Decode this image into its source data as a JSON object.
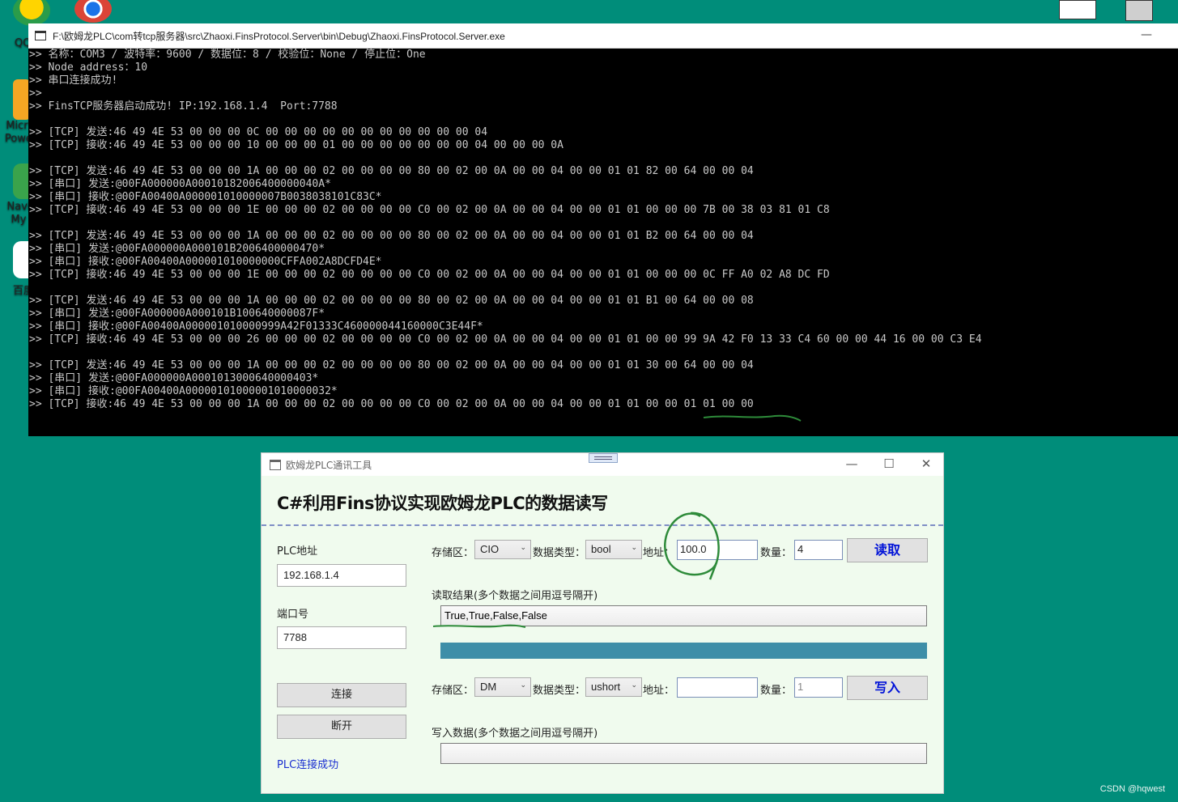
{
  "desktop": {
    "icons": [
      {
        "label": "QQ"
      },
      {
        "label": ""
      },
      {
        "label": "Micr Powe"
      },
      {
        "label": "Navi My"
      },
      {
        "label": "百度"
      }
    ]
  },
  "console": {
    "title": "F:\\欧姆龙PLC\\com转tcp服务器\\src\\Zhaoxi.FinsProtocol.Server\\bin\\Debug\\Zhaoxi.FinsProtocol.Server.exe",
    "min_label": "—",
    "lines": [
      ">> 名称：COM3 / 波特率：9600 / 数据位：8 / 校验位：None / 停止位：One",
      ">> Node address：10",
      ">> 串口连接成功!",
      ">>",
      ">> FinsTCP服务器启动成功! IP:192.168.1.4  Port:7788",
      "",
      ">> [TCP] 发送:46 49 4E 53 00 00 00 0C 00 00 00 00 00 00 00 00 00 00 00 04",
      ">> [TCP] 接收:46 49 4E 53 00 00 00 10 00 00 00 01 00 00 00 00 00 00 00 04 00 00 00 0A",
      "",
      ">> [TCP] 发送:46 49 4E 53 00 00 00 1A 00 00 00 02 00 00 00 00 80 00 02 00 0A 00 00 04 00 00 01 01 82 00 64 00 00 04",
      ">> [串口] 发送:@00FA000000A00010182006400000040A*",
      ">> [串口] 接收:@00FA00400A000001010000007B0038038101C83C*",
      ">> [TCP] 接收:46 49 4E 53 00 00 00 1E 00 00 00 02 00 00 00 00 C0 00 02 00 0A 00 00 04 00 00 01 01 00 00 00 7B 00 38 03 81 01 C8",
      "",
      ">> [TCP] 发送:46 49 4E 53 00 00 00 1A 00 00 00 02 00 00 00 00 80 00 02 00 0A 00 00 04 00 00 01 01 B2 00 64 00 00 04",
      ">> [串口] 发送:@00FA000000A000101B2006400000470*",
      ">> [串口] 接收:@00FA00400A000001010000000CFFA002A8DCFD4E*",
      ">> [TCP] 接收:46 49 4E 53 00 00 00 1E 00 00 00 02 00 00 00 00 C0 00 02 00 0A 00 00 04 00 00 01 01 00 00 00 0C FF A0 02 A8 DC FD",
      "",
      ">> [TCP] 发送:46 49 4E 53 00 00 00 1A 00 00 00 02 00 00 00 00 80 00 02 00 0A 00 00 04 00 00 01 01 B1 00 64 00 00 08",
      ">> [串口] 发送:@00FA000000A000101B100640000087F*",
      ">> [串口] 接收:@00FA00400A000001010000999A42F01333C460000044160000C3E44F*",
      ">> [TCP] 接收:46 49 4E 53 00 00 00 26 00 00 00 02 00 00 00 00 C0 00 02 00 0A 00 00 04 00 00 01 01 00 00 99 9A 42 F0 13 33 C4 60 00 00 44 16 00 00 C3 E4",
      "",
      ">> [TCP] 发送:46 49 4E 53 00 00 00 1A 00 00 00 02 00 00 00 00 80 00 02 00 0A 00 00 04 00 00 01 01 30 00 64 00 00 04",
      ">> [串口] 发送:@00FA000000A0001013000640000403*",
      ">> [串口] 接收:@00FA00400A00000101000001010000032*",
      ">> [TCP] 接收:46 49 4E 53 00 00 00 1A 00 00 00 02 00 00 00 00 C0 00 02 00 0A 00 00 04 00 00 01 01 00 00 01 01 00 00"
    ]
  },
  "form": {
    "title": "欧姆龙PLC通讯工具",
    "heading": "C#利用Fins协议实现欧姆龙PLC的数据读写",
    "plc_address_label": "PLC地址",
    "plc_address_value": "192.168.1.4",
    "port_label": "端口号",
    "port_value": "7788",
    "connect_label": "连接",
    "disconnect_label": "断开",
    "status": "PLC连接成功",
    "read": {
      "area_label": "存储区：",
      "area_value": "CIO",
      "type_label": "数据类型：",
      "type_value": "bool",
      "addr_label": "地址：",
      "addr_value": "100.0",
      "count_label": "数量：",
      "count_value": "4",
      "button": "读取",
      "result_label": "读取结果(多个数据之间用逗号隔开)",
      "result_value": "True,True,False,False"
    },
    "write": {
      "area_label": "存储区：",
      "area_value": "DM",
      "type_label": "数据类型：",
      "type_value": "ushort",
      "addr_label": "地址：",
      "addr_value": "",
      "count_label": "数量：",
      "count_value": "1",
      "button": "写入",
      "data_label": "写入数据(多个数据之间用逗号隔开)",
      "data_value": ""
    },
    "window_buttons": {
      "min": "—",
      "max": "☐",
      "close": "✕"
    },
    "progress": 1.0,
    "colors": {
      "progress": "#3e8ea8",
      "accent_text": "#0012d8",
      "status_text": "#1a2fd0",
      "annotation": "#2e8b3a"
    }
  },
  "watermark": "CSDN @hqwest"
}
